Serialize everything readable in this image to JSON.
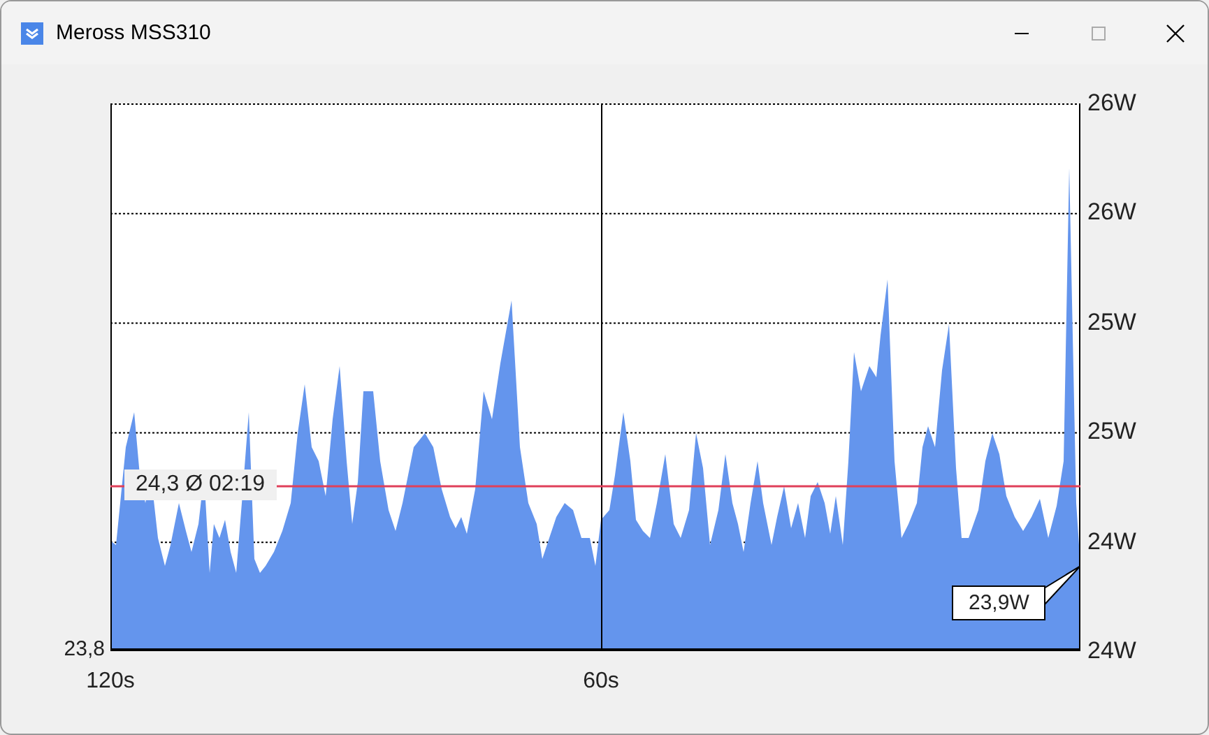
{
  "window": {
    "title": "Meross MSS310",
    "controls": [
      {
        "kind": "minimize",
        "disabled": false
      },
      {
        "kind": "maximize",
        "disabled": true
      },
      {
        "kind": "close",
        "disabled": false
      }
    ]
  },
  "chart": {
    "y_axis_labels": [
      "26W",
      "26W",
      "25W",
      "25W",
      "24W",
      "24W"
    ],
    "x_axis_labels": [
      "120s",
      "60s"
    ],
    "min_label": "23,8",
    "average_label": "24,3 Ø 02:19",
    "current_value": "23,9W"
  }
}
